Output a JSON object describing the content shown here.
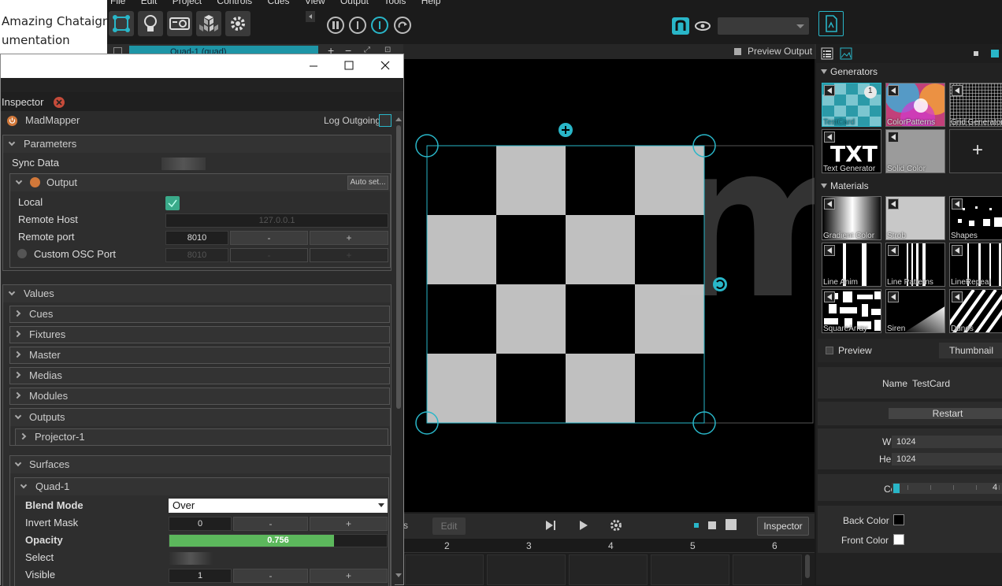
{
  "background_doc": {
    "line1": "Amazing Chataigne",
    "line2": "umentation"
  },
  "menubar": {
    "items": [
      "File",
      "Edit",
      "Project",
      "Controls",
      "Cues",
      "View",
      "Output",
      "Tools",
      "Help"
    ]
  },
  "toolbar": {
    "icons": [
      "surface-tool-icon",
      "lightbulb-icon",
      "projector-icon",
      "cubes-icon",
      "gear-icon",
      "pause-icon",
      "stop-icon",
      "play-icon",
      "redo-icon",
      "madmapper-logo",
      "eye-icon",
      "file-icon"
    ]
  },
  "surface_bar": {
    "label": "Quad-1 (quad)"
  },
  "preview": {
    "label": "Preview Output",
    "watermark": "m"
  },
  "cues_bar": {
    "left_label": "s",
    "edit_label": "Edit",
    "inspector_label": "Inspector"
  },
  "cue_columns": [
    "2",
    "3",
    "4",
    "5",
    "6"
  ],
  "right_panel": {
    "generators_label": "Generators",
    "generators": [
      {
        "name": "TestCard",
        "badge": "1"
      },
      {
        "name": "ColorPatterns"
      },
      {
        "name": "Grid Generator"
      },
      {
        "name": "Text Generator",
        "text": "TXT"
      },
      {
        "name": "Solid Color"
      },
      {
        "name": "",
        "add": "+"
      }
    ],
    "materials_label": "Materials",
    "materials": [
      "Gradient Color",
      "Strob",
      "Shapes",
      "Line Anim",
      "Line Patterns",
      "LineRepeat",
      "SquareArray",
      "Siren",
      "Dunes"
    ],
    "preview_label": "Preview",
    "thumbnail_label": "Thumbnail",
    "name_label": "Name",
    "name_value": "TestCard",
    "restart_label": "Restart",
    "width_label": "Width",
    "width_value": "1024",
    "height_label": "Height",
    "height_value": "1024",
    "count_label": "Count",
    "count_value": "4",
    "back_color_label": "Back Color",
    "back_color": "#000000",
    "front_color_label": "Front Color",
    "front_color": "#ffffff"
  },
  "inspector": {
    "tab_label": "Inspector",
    "module_name": "MadMapper",
    "log_outgoing_label": "Log Outgoing",
    "parameters_label": "Parameters",
    "sync_data_label": "Sync Data",
    "output_label": "Output",
    "auto_set_label": "Auto set...",
    "local_label": "Local",
    "remote_host_label": "Remote Host",
    "remote_host_value": "127.0.0.1",
    "remote_port_label": "Remote port",
    "remote_port_value": "8010",
    "custom_osc_label": "Custom OSC Port",
    "custom_osc_value": "8010",
    "minus": "-",
    "plus": "+",
    "values_label": "Values",
    "collapsed_groups": [
      "Cues",
      "Fixtures",
      "Master",
      "Medias",
      "Modules"
    ],
    "outputs_label": "Outputs",
    "projector_label": "Projector-1",
    "surfaces_label": "Surfaces",
    "quad_label": "Quad-1",
    "blend_mode_label": "Blend Mode",
    "blend_mode_value": "Over",
    "invert_mask_label": "Invert Mask",
    "invert_mask_value": "0",
    "opacity_label": "Opacity",
    "opacity_value": "0.756",
    "opacity_fraction": 0.756,
    "select_label": "Select",
    "visible_label": "Visible",
    "visible_value": "1"
  },
  "colors": {
    "accent": "#1e95a6",
    "opacity_fill": "#5cb85c",
    "check": "#3aaa8a"
  }
}
